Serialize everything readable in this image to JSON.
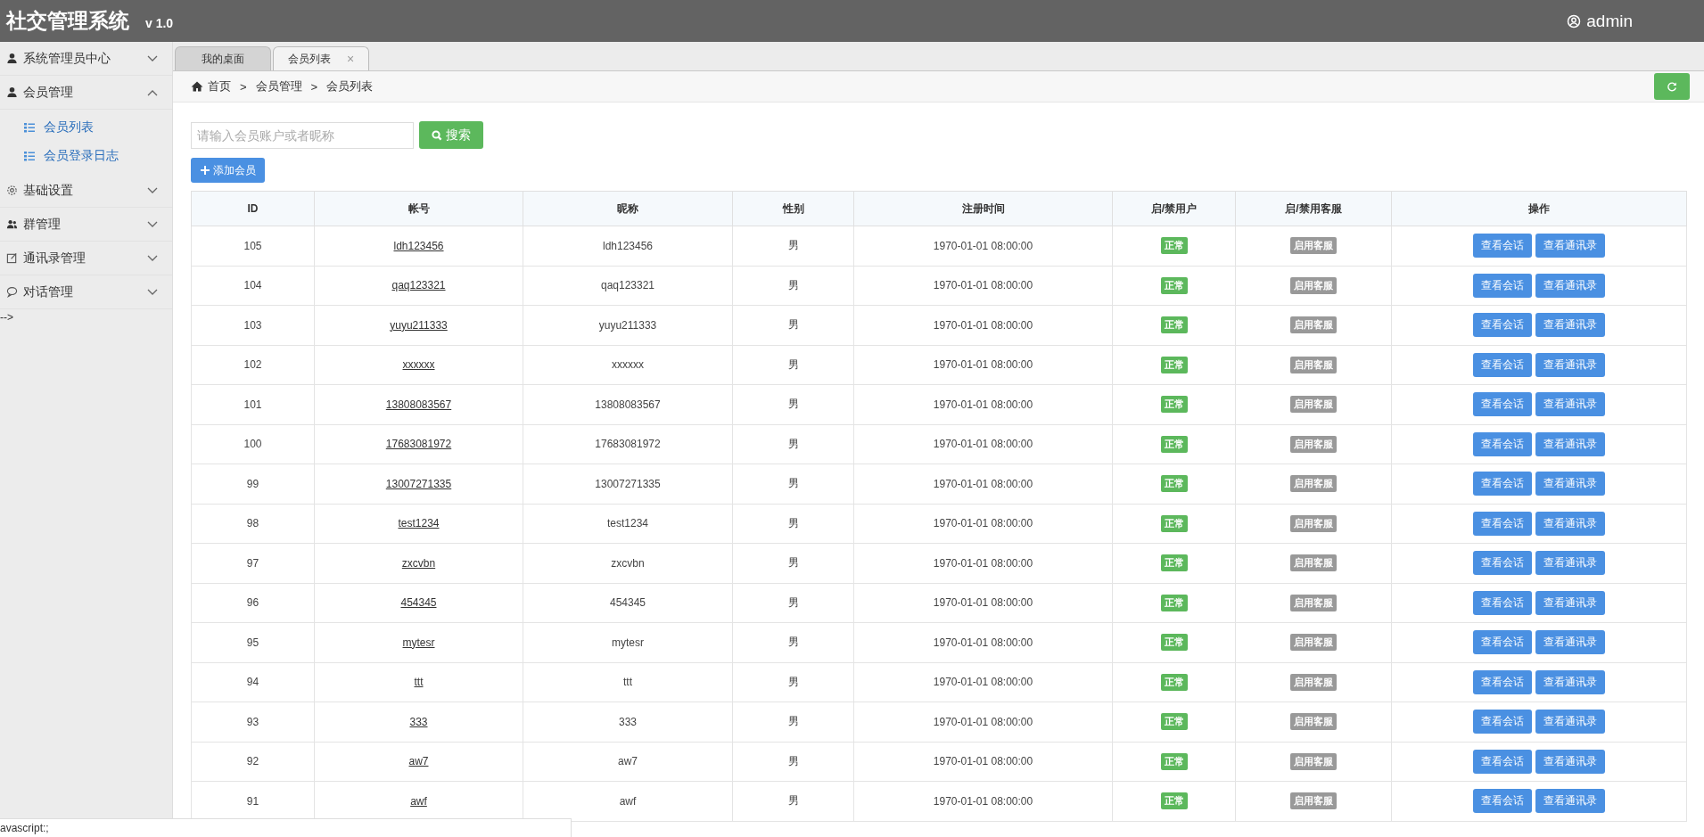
{
  "header": {
    "title": "社交管理系统",
    "version": "v 1.0",
    "user": "admin"
  },
  "sidebar": {
    "items": [
      {
        "label": "系统管理员中心",
        "expanded": false
      },
      {
        "label": "会员管理",
        "expanded": true,
        "children": [
          {
            "label": "会员列表"
          },
          {
            "label": "会员登录日志"
          }
        ]
      },
      {
        "label": "基础设置",
        "expanded": false
      },
      {
        "label": "群管理",
        "expanded": false
      },
      {
        "label": "通讯录管理",
        "expanded": false
      },
      {
        "label": "对话管理",
        "expanded": false
      }
    ],
    "stray_text": "-->"
  },
  "tabs": [
    {
      "label": "我的桌面",
      "selected": false
    },
    {
      "label": "会员列表",
      "selected": true,
      "close": "×"
    }
  ],
  "breadcrumb": [
    "首页",
    ">",
    "会员管理",
    ">",
    "会员列表"
  ],
  "search": {
    "placeholder": "请输入会员账户或者昵称",
    "button": "搜索"
  },
  "add_button": "添加会员",
  "table": {
    "columns": [
      "ID",
      "帐号",
      "昵称",
      "性别",
      "注册时间",
      "启/禁用户",
      "启/禁用客服",
      "操作"
    ],
    "rows": [
      {
        "id": "105",
        "account": "ldh123456",
        "nickname": "ldh123456",
        "gender": "男",
        "time": "1970-01-01 08:00:00",
        "status": "正常",
        "service": "启用客服",
        "actions": [
          "查看会话",
          "查看通讯录"
        ]
      },
      {
        "id": "104",
        "account": "qaq123321",
        "nickname": "qaq123321",
        "gender": "男",
        "time": "1970-01-01 08:00:00",
        "status": "正常",
        "service": "启用客服",
        "actions": [
          "查看会话",
          "查看通讯录"
        ]
      },
      {
        "id": "103",
        "account": "yuyu211333",
        "nickname": "yuyu211333",
        "gender": "男",
        "time": "1970-01-01 08:00:00",
        "status": "正常",
        "service": "启用客服",
        "actions": [
          "查看会话",
          "查看通讯录"
        ]
      },
      {
        "id": "102",
        "account": "xxxxxx",
        "nickname": "xxxxxx",
        "gender": "男",
        "time": "1970-01-01 08:00:00",
        "status": "正常",
        "service": "启用客服",
        "actions": [
          "查看会话",
          "查看通讯录"
        ]
      },
      {
        "id": "101",
        "account": "13808083567",
        "nickname": "13808083567",
        "gender": "男",
        "time": "1970-01-01 08:00:00",
        "status": "正常",
        "service": "启用客服",
        "actions": [
          "查看会话",
          "查看通讯录"
        ]
      },
      {
        "id": "100",
        "account": "17683081972",
        "nickname": "17683081972",
        "gender": "男",
        "time": "1970-01-01 08:00:00",
        "status": "正常",
        "service": "启用客服",
        "actions": [
          "查看会话",
          "查看通讯录"
        ]
      },
      {
        "id": "99",
        "account": "13007271335",
        "nickname": "13007271335",
        "gender": "男",
        "time": "1970-01-01 08:00:00",
        "status": "正常",
        "service": "启用客服",
        "actions": [
          "查看会话",
          "查看通讯录"
        ]
      },
      {
        "id": "98",
        "account": "test1234",
        "nickname": "test1234",
        "gender": "男",
        "time": "1970-01-01 08:00:00",
        "status": "正常",
        "service": "启用客服",
        "actions": [
          "查看会话",
          "查看通讯录"
        ]
      },
      {
        "id": "97",
        "account": "zxcvbn",
        "nickname": "zxcvbn",
        "gender": "男",
        "time": "1970-01-01 08:00:00",
        "status": "正常",
        "service": "启用客服",
        "actions": [
          "查看会话",
          "查看通讯录"
        ]
      },
      {
        "id": "96",
        "account": "454345",
        "nickname": "454345",
        "gender": "男",
        "time": "1970-01-01 08:00:00",
        "status": "正常",
        "service": "启用客服",
        "actions": [
          "查看会话",
          "查看通讯录"
        ]
      },
      {
        "id": "95",
        "account": "mytesr",
        "nickname": "mytesr",
        "gender": "男",
        "time": "1970-01-01 08:00:00",
        "status": "正常",
        "service": "启用客服",
        "actions": [
          "查看会话",
          "查看通讯录"
        ]
      },
      {
        "id": "94",
        "account": "ttt",
        "nickname": "ttt",
        "gender": "男",
        "time": "1970-01-01 08:00:00",
        "status": "正常",
        "service": "启用客服",
        "actions": [
          "查看会话",
          "查看通讯录"
        ]
      },
      {
        "id": "93",
        "account": "333",
        "nickname": "333",
        "gender": "男",
        "time": "1970-01-01 08:00:00",
        "status": "正常",
        "service": "启用客服",
        "actions": [
          "查看会话",
          "查看通讯录"
        ]
      },
      {
        "id": "92",
        "account": "aw7",
        "nickname": "aw7",
        "gender": "男",
        "time": "1970-01-01 08:00:00",
        "status": "正常",
        "service": "启用客服",
        "actions": [
          "查看会话",
          "查看通讯录"
        ]
      },
      {
        "id": "91",
        "account": "awf",
        "nickname": "awf",
        "gender": "男",
        "time": "1970-01-01 08:00:00",
        "status": "正常",
        "service": "启用客服",
        "actions": [
          "查看会话",
          "查看通讯录"
        ]
      }
    ]
  },
  "status_bar": "avascript:;"
}
